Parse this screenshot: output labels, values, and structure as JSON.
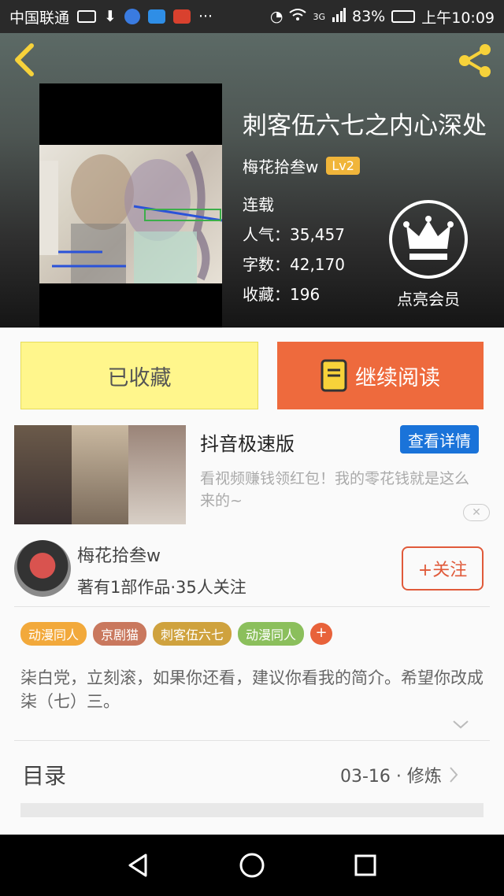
{
  "status_bar": {
    "carrier": "中国联通",
    "more": "···",
    "network": "3G",
    "battery": "83%",
    "time": "上午10:09"
  },
  "header": {
    "book_title": "刺客伍六七之内心深处",
    "author": "梅花拾叁w",
    "level": "Lv2",
    "status": "连载",
    "popularity": "人气：35,457",
    "word_count": "字数：42,170",
    "favorites": "收藏：196",
    "vip_label": "点亮会员"
  },
  "actions": {
    "collect_label": "已收藏",
    "read_label": "继续阅读"
  },
  "ad": {
    "title": "抖音极速版",
    "detail_label": "查看详情",
    "description": "看视频赚钱领红包！我的零花钱就是这么来的~"
  },
  "author_card": {
    "name": "梅花拾叁w",
    "info": "著有1部作品·35人关注",
    "follow_label": "+关注"
  },
  "tags": [
    {
      "label": "动漫同人",
      "color": "#f2a93b"
    },
    {
      "label": "京剧猫",
      "color": "#c9785e"
    },
    {
      "label": "刺客伍六七",
      "color": "#cfa23e"
    },
    {
      "label": "动漫同人",
      "color": "#8bbf5c"
    }
  ],
  "tag_add": "+",
  "synopsis": "柒白党，立刻滚，如果你还看，建议你看我的简介。希望你改成柒（七）三。",
  "toc": {
    "label": "目录",
    "latest": "03-16 · 修炼"
  },
  "colors": {
    "accent_yellow": "#f7d23a",
    "read_orange": "#ee6a3d",
    "collect_yellow": "#fff68c",
    "follow_red": "#e05a3a",
    "ad_blue": "#1a73d9"
  }
}
